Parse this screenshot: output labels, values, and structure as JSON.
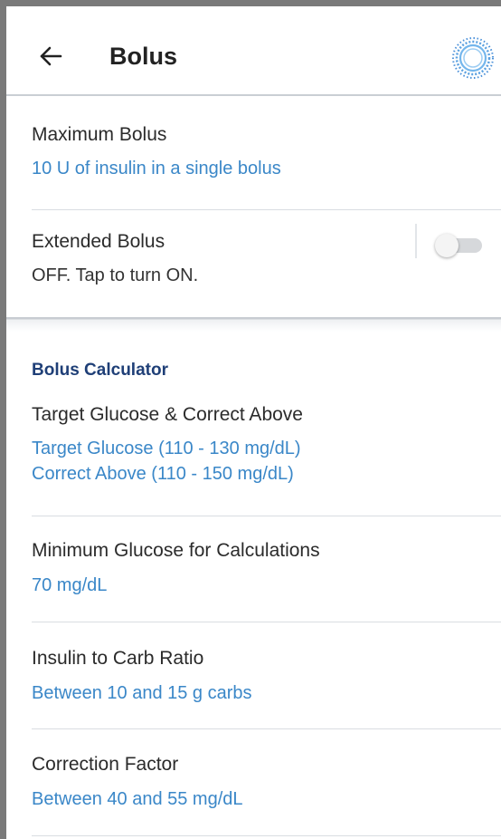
{
  "header": {
    "title": "Bolus",
    "back_icon": "arrow-left-icon",
    "status_icon": "pod-status-icon"
  },
  "max_bolus": {
    "label": "Maximum Bolus",
    "value": "10 U of insulin in a single bolus"
  },
  "extended_bolus": {
    "label": "Extended Bolus",
    "value": "OFF. Tap to turn ON.",
    "toggle_on": false
  },
  "bolus_calculator": {
    "title": "Bolus Calculator",
    "items": [
      {
        "label": "Target Glucose & Correct Above",
        "values": [
          "Target Glucose (110 - 130 mg/dL)",
          "Correct Above (110 - 150 mg/dL)"
        ]
      },
      {
        "label": "Minimum Glucose for Calculations",
        "values": [
          "70 mg/dL"
        ]
      },
      {
        "label": "Insulin to Carb Ratio",
        "values": [
          "Between 10 and 15 g carbs"
        ]
      },
      {
        "label": "Correction Factor",
        "values": [
          "Between 40 and 55 mg/dL"
        ]
      }
    ]
  },
  "colors": {
    "accent_blue": "#3a87c8",
    "section_title": "#1f3f77",
    "frame": "#7a7a7a"
  }
}
